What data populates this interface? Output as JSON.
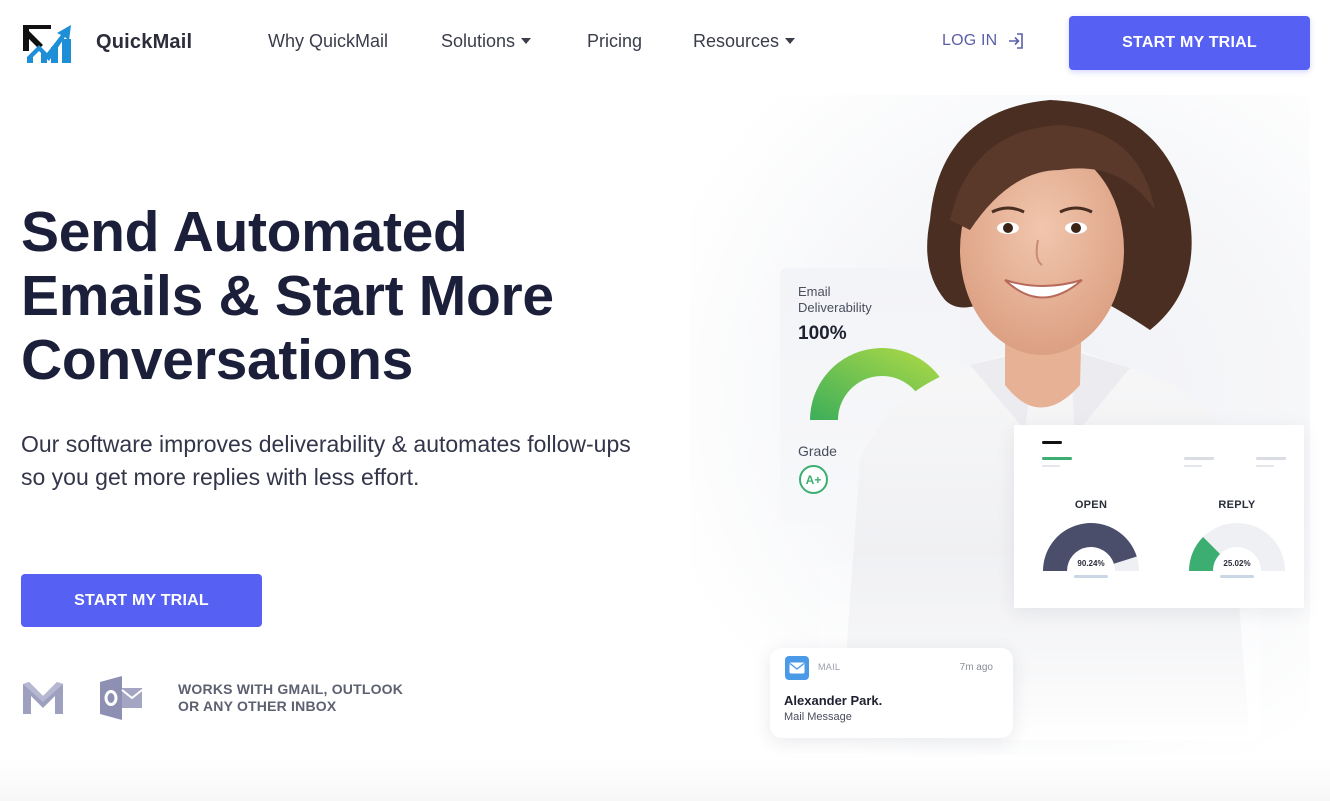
{
  "header": {
    "brand": "QuickMail",
    "logo_icon": "quickmail-envelope-chart-logo",
    "nav": [
      {
        "label": "Why QuickMail",
        "has_dropdown": false
      },
      {
        "label": "Solutions",
        "has_dropdown": true
      },
      {
        "label": "Pricing",
        "has_dropdown": false
      },
      {
        "label": "Resources",
        "has_dropdown": true
      }
    ],
    "login_label": "LOG IN",
    "login_icon": "sign-in-arrow-icon",
    "cta_label": "START MY TRIAL"
  },
  "hero": {
    "title_lines": [
      "Send Automated",
      "Emails & Start More",
      "Conversations"
    ],
    "subtitle": "Our software improves deliverability & automates follow-ups so you get more replies with less effort.",
    "cta_label": "START MY TRIAL",
    "works_with_line1": "WORKS WITH GMAIL, OUTLOOK",
    "works_with_line2": "OR ANY OTHER INBOX",
    "integration_icons": [
      "gmail-icon",
      "outlook-icon"
    ]
  },
  "visual": {
    "deliverability": {
      "label_line1": "Email",
      "label_line2": "Deliverability",
      "value": "100%",
      "percent": 100,
      "grade_label": "Grade",
      "grade": "A+"
    },
    "stats": [
      {
        "label": "OPEN",
        "value": "90.24%",
        "percent": 90.24,
        "color": "#4a4e6b"
      },
      {
        "label": "REPLY",
        "value": "25.02%",
        "percent": 25.02,
        "color": "#3cae72"
      }
    ],
    "notification": {
      "app": "MAIL",
      "time": "7m ago",
      "sender": "Alexander Park.",
      "subject": "Mail Message"
    }
  },
  "colors": {
    "accent": "#5660f2",
    "heading": "#1c1f3a",
    "gauge_green_start": "#3cae5a",
    "gauge_green_end": "#b4dc45",
    "open_gauge": "#4a4e6b",
    "reply_gauge": "#3cae72"
  }
}
